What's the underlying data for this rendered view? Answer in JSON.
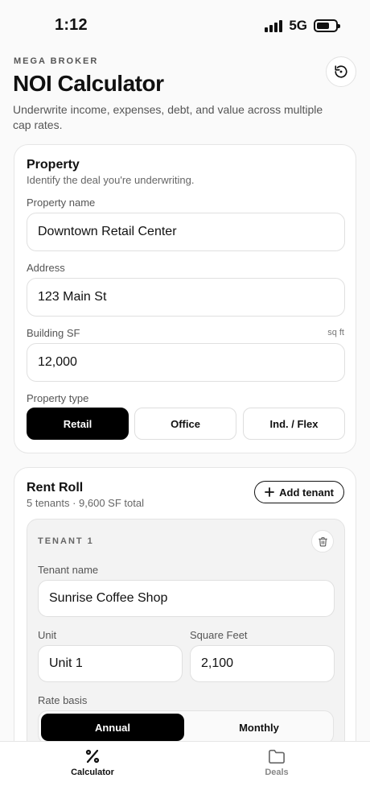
{
  "status": {
    "time": "1:12",
    "network": "5G"
  },
  "header": {
    "brand": "MEGA BROKER",
    "title": "NOI Calculator",
    "subtitle": "Underwrite income, expenses, debt, and value across multiple cap rates."
  },
  "property": {
    "title": "Property",
    "subtitle": "Identify the deal you're underwriting.",
    "name_label": "Property name",
    "name_value": "Downtown Retail Center",
    "address_label": "Address",
    "address_value": "123 Main St",
    "sf_label": "Building SF",
    "sf_unit": "sq ft",
    "sf_value": "12,000",
    "type_label": "Property type",
    "types": [
      "Retail",
      "Office",
      "Ind. / Flex"
    ],
    "selected_type": "Retail"
  },
  "rent_roll": {
    "title": "Rent Roll",
    "summary": "5 tenants · 9,600 SF total",
    "add_label": "Add tenant",
    "tenant": {
      "header": "TENANT 1",
      "name_label": "Tenant name",
      "name_value": "Sunrise Coffee Shop",
      "unit_label": "Unit",
      "unit_value": "Unit 1",
      "sf_label": "Square Feet",
      "sf_value": "2,100",
      "basis_label": "Rate basis",
      "basis_options": [
        "Annual",
        "Monthly"
      ],
      "selected_basis": "Annual"
    }
  },
  "tabs": [
    {
      "label": "Calculator",
      "icon": "percent-icon",
      "active": true
    },
    {
      "label": "Deals",
      "icon": "folder-icon",
      "active": false
    }
  ]
}
